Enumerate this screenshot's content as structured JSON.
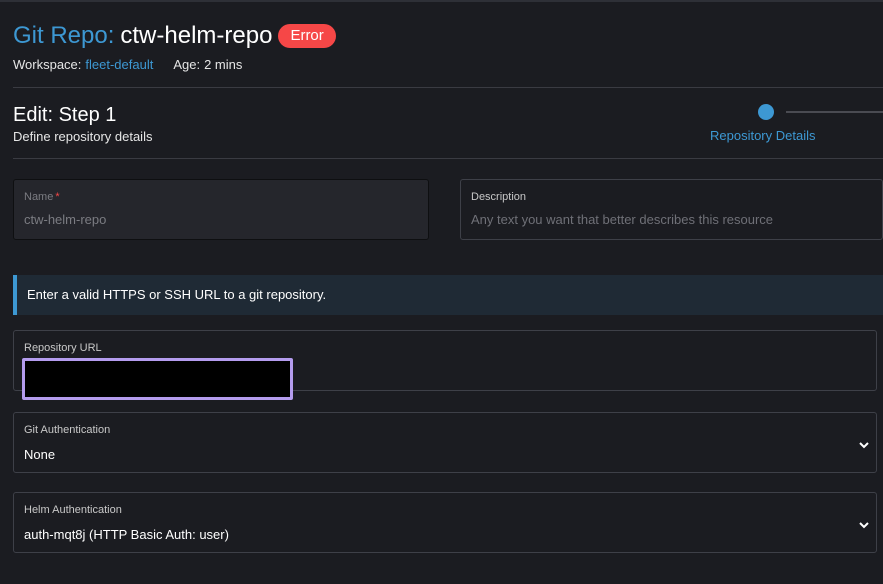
{
  "header": {
    "title_prefix": "Git Repo:",
    "title_name": "ctw-helm-repo",
    "status_badge": "Error",
    "workspace_label": "Workspace:",
    "workspace_value": "fleet-default",
    "age_label": "Age:",
    "age_value": "2 mins"
  },
  "step": {
    "title": "Edit: Step 1",
    "subtitle": "Define repository details"
  },
  "stepper": {
    "current_label": "Repository Details"
  },
  "form": {
    "name": {
      "label": "Name",
      "required_mark": "*",
      "value": "ctw-helm-repo"
    },
    "description": {
      "label": "Description",
      "placeholder": "Any text you want that better describes this resource"
    },
    "banner": "Enter a valid HTTPS or SSH URL to a git repository.",
    "repo_url": {
      "label": "Repository URL",
      "value": ""
    },
    "git_auth": {
      "label": "Git Authentication",
      "selected": "None"
    },
    "helm_auth": {
      "label": "Helm Authentication",
      "selected": "auth-mqt8j (HTTP Basic Auth: user)"
    }
  },
  "colors": {
    "accent": "#3d98d3",
    "error": "#f64747",
    "background": "#1b1c21",
    "highlight": "#b49cee"
  },
  "icons": {
    "select_chevron": "chevron-down-icon"
  }
}
